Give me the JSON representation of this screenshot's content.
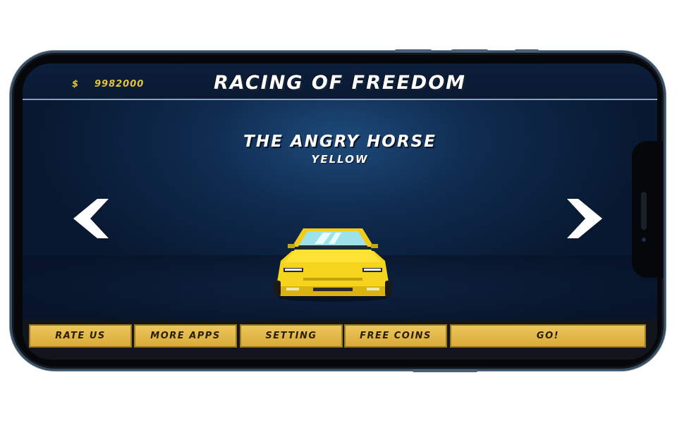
{
  "currency": {
    "symbol": "$",
    "amount": "9982000"
  },
  "title": "RACING OF FREEDOM",
  "car": {
    "name": "THE ANGRY HORSE",
    "color_name": "YELLOW",
    "paint": "#f5d41c"
  },
  "icons": {
    "prev": "chevron-left-icon",
    "next": "chevron-right-icon"
  },
  "buttons": {
    "rate": "RATE US",
    "more_apps": "MORE APPS",
    "setting": "SETTING",
    "free_coins": "FREE COINS",
    "go": "GO!"
  },
  "colors": {
    "accent_gold": "#e5c33a",
    "button": "#e2b84a",
    "background": "#0f2b4f"
  }
}
